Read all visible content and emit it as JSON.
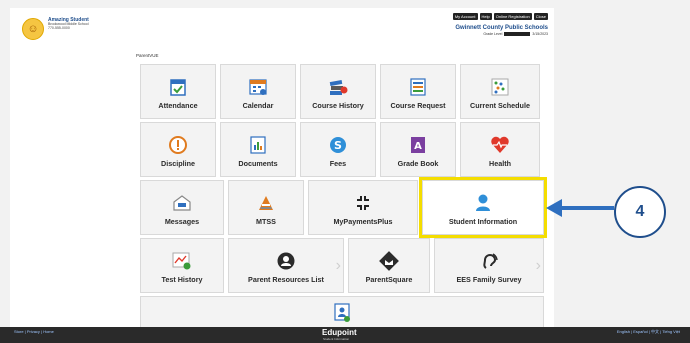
{
  "header": {
    "user_name": "Amazing Student",
    "user_school": "Brookwood Middle School",
    "user_phone": "770-555-0000",
    "top_links": [
      "My Account",
      "Help",
      "Online Registration",
      "Close"
    ],
    "district_name": "Gwinnett County Public Schools",
    "district_sub": "Grade Level",
    "district_date": "3/15/2023"
  },
  "breadcrumb": "ParentVUE",
  "tiles": [
    {
      "label": "Attendance",
      "icon": "attendance-icon"
    },
    {
      "label": "Calendar",
      "icon": "calendar-icon"
    },
    {
      "label": "Course History",
      "icon": "course-history-icon"
    },
    {
      "label": "Course Request",
      "icon": "course-request-icon"
    },
    {
      "label": "Current Schedule",
      "icon": "schedule-icon"
    },
    {
      "label": "Discipline",
      "icon": "discipline-icon"
    },
    {
      "label": "Documents",
      "icon": "documents-icon"
    },
    {
      "label": "Fees",
      "icon": "fees-icon"
    },
    {
      "label": "Grade Book",
      "icon": "grade-book-icon"
    },
    {
      "label": "Health",
      "icon": "health-icon"
    },
    {
      "label": "Messages",
      "icon": "messages-icon"
    },
    {
      "label": "MTSS",
      "icon": "mtss-icon"
    },
    {
      "label": "MyPaymentsPlus",
      "icon": "payments-icon"
    },
    {
      "label": "Student Information",
      "icon": "student-info-icon"
    },
    {
      "label": "Test History",
      "icon": "test-history-icon"
    },
    {
      "label": "Parent Resources List",
      "icon": "parent-resources-icon"
    },
    {
      "label": "ParentSquare",
      "icon": "parentsquare-icon"
    },
    {
      "label": "EES Family Survey",
      "icon": "survey-icon"
    },
    {
      "label": "",
      "icon": "student-view-icon"
    }
  ],
  "callout": "4",
  "colors": {
    "highlight": "#f4dd00",
    "callout": "#1f4e8c",
    "accent_blue": "#2f6fbf"
  },
  "footer": {
    "left": "Store | Privacy | Home",
    "logo": "Edupoint",
    "logo_sub": "Student Information",
    "right": "English | Español | 中文 | Tiếng Việt"
  }
}
